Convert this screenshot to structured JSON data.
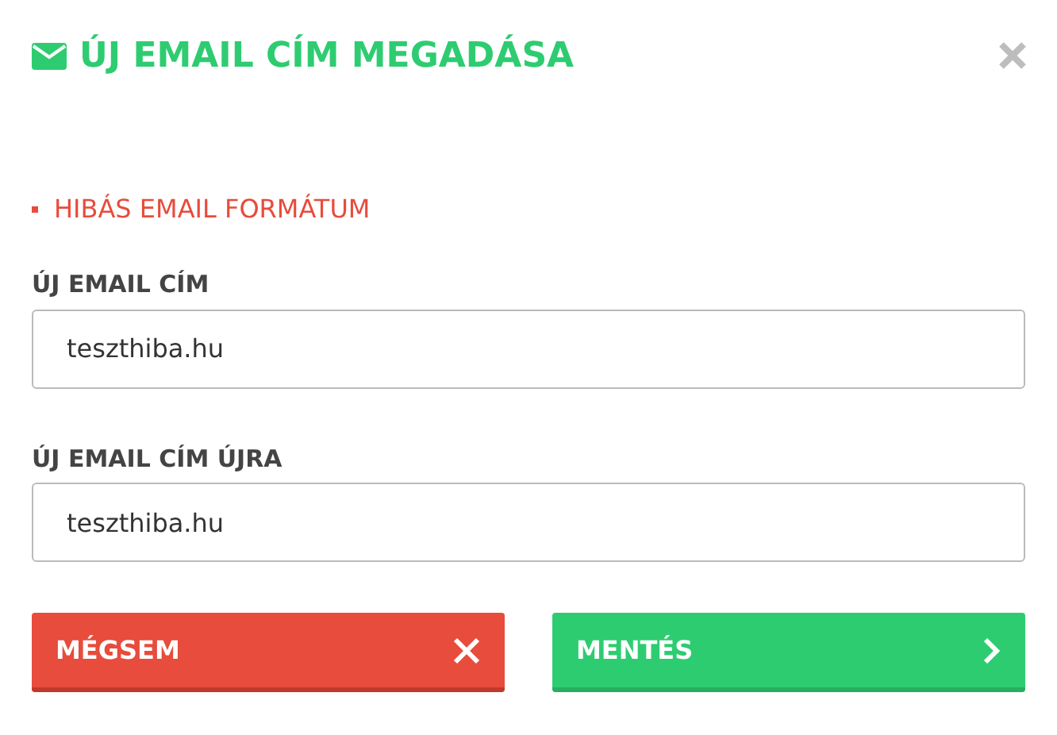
{
  "dialog": {
    "title": "ÚJ EMAIL CÍM MEGADÁSA"
  },
  "errors": [
    "HIBÁS EMAIL FORMÁTUM"
  ],
  "fields": [
    {
      "label": "ÚJ EMAIL CÍM",
      "value": "teszthiba.hu"
    },
    {
      "label": "ÚJ EMAIL CÍM ÚJRA",
      "value": "teszthiba.hu"
    }
  ],
  "buttons": [
    {
      "kind": "cancel",
      "label": "MÉGSEM"
    },
    {
      "kind": "save",
      "label": "MENTÉS"
    }
  ]
}
